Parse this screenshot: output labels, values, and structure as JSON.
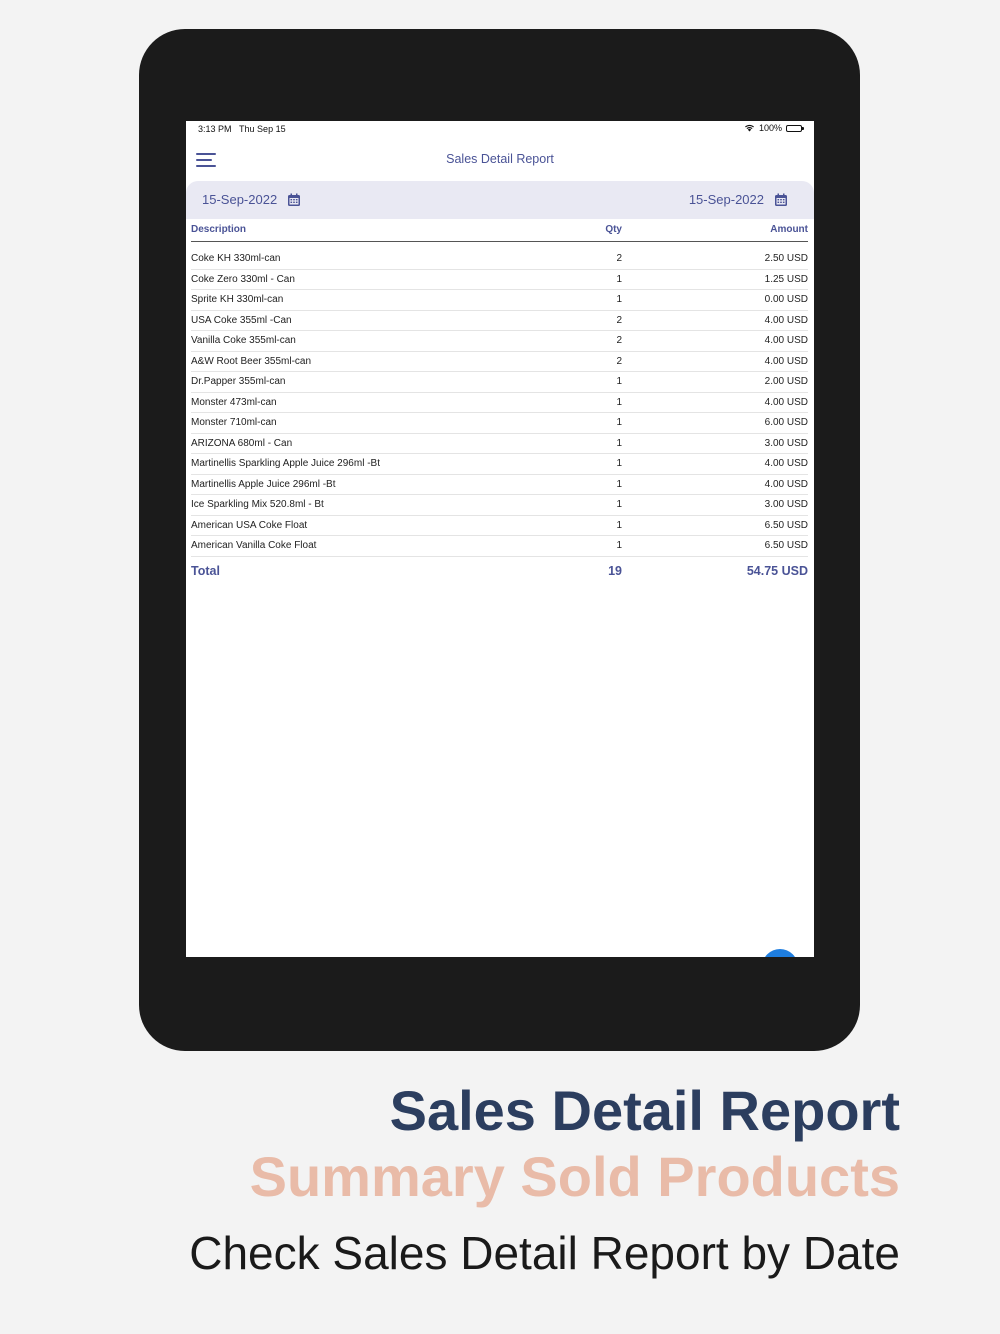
{
  "status": {
    "time": "3:13 PM",
    "date": "Thu Sep 15",
    "battery": "100%"
  },
  "app": {
    "title": "Sales Detail Report"
  },
  "dates": {
    "from": "15-Sep-2022",
    "to": "15-Sep-2022"
  },
  "table": {
    "headers": {
      "description": "Description",
      "qty": "Qty",
      "amount": "Amount"
    },
    "rows": [
      {
        "description": "Coke KH 330ml-can",
        "qty": "2",
        "amount": "2.50 USD"
      },
      {
        "description": "Coke Zero 330ml - Can",
        "qty": "1",
        "amount": "1.25 USD"
      },
      {
        "description": "Sprite KH 330ml-can",
        "qty": "1",
        "amount": "0.00 USD"
      },
      {
        "description": "USA Coke 355ml -Can",
        "qty": "2",
        "amount": "4.00 USD"
      },
      {
        "description": "Vanilla Coke 355ml-can",
        "qty": "2",
        "amount": "4.00 USD"
      },
      {
        "description": "A&W Root Beer 355ml-can",
        "qty": "2",
        "amount": "4.00 USD"
      },
      {
        "description": "Dr.Papper 355ml-can",
        "qty": "1",
        "amount": "2.00 USD"
      },
      {
        "description": "Monster 473ml-can",
        "qty": "1",
        "amount": "4.00 USD"
      },
      {
        "description": "Monster 710ml-can",
        "qty": "1",
        "amount": "6.00 USD"
      },
      {
        "description": "ARIZONA 680ml - Can",
        "qty": "1",
        "amount": "3.00 USD"
      },
      {
        "description": "Martinellis Sparkling Apple Juice 296ml -Bt",
        "qty": "1",
        "amount": "4.00 USD"
      },
      {
        "description": "Martinellis Apple Juice 296ml -Bt",
        "qty": "1",
        "amount": "4.00 USD"
      },
      {
        "description": "Ice Sparkling Mix 520.8ml - Bt",
        "qty": "1",
        "amount": "3.00 USD"
      },
      {
        "description": "American USA Coke Float",
        "qty": "1",
        "amount": "6.50 USD"
      },
      {
        "description": "American Vanilla Coke Float",
        "qty": "1",
        "amount": "6.50 USD"
      }
    ],
    "total": {
      "label": "Total",
      "qty": "19",
      "amount": "54.75 USD"
    }
  },
  "caption": {
    "title": "Sales Detail Report",
    "subtitle": "Summary Sold Products",
    "description": "Check Sales Detail Report by Date"
  },
  "colors": {
    "accent": "#4a5396",
    "caption_title": "#2c3e5f",
    "caption_subtitle": "#e9bba8",
    "fab": "#1e7ee0"
  }
}
